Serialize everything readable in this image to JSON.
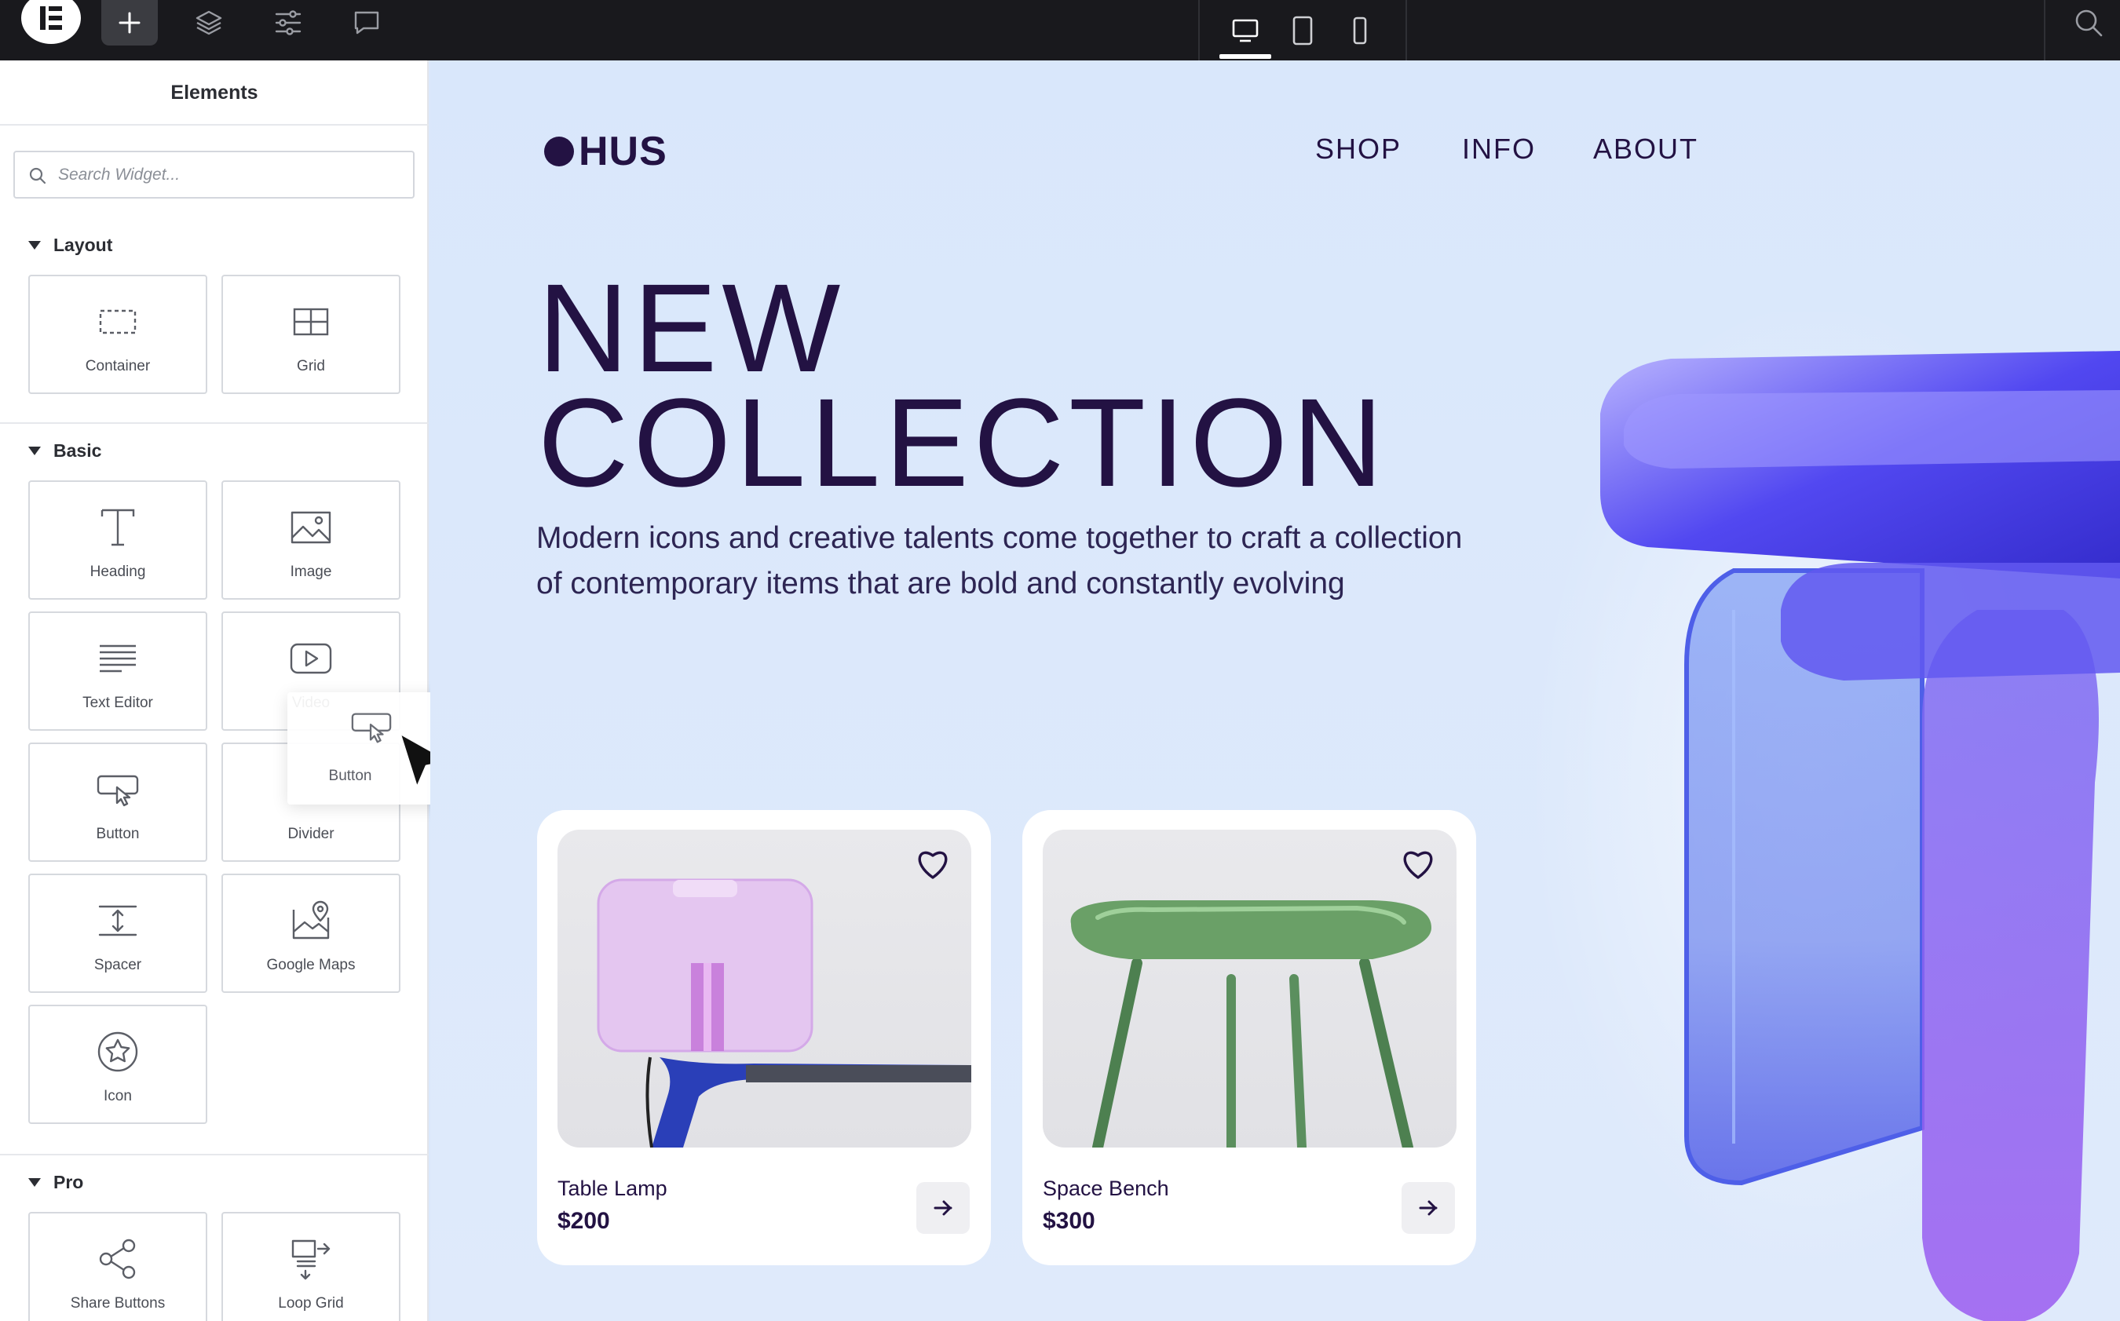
{
  "topbar": {
    "logo_icon": "elementor-logo-icon",
    "tools": [
      "add-icon",
      "layers-icon",
      "settings-sliders-icon",
      "comment-icon"
    ],
    "devices": [
      "desktop-icon",
      "tablet-icon",
      "mobile-icon"
    ],
    "active_device": "desktop",
    "right_icon": "search-icon"
  },
  "sidebar": {
    "title": "Elements",
    "search": {
      "placeholder": "Search Widget..."
    },
    "sections": [
      {
        "label": "Layout",
        "widgets": [
          "Container",
          "Grid"
        ]
      },
      {
        "label": "Basic",
        "widgets": [
          "Heading",
          "Image",
          "Text Editor",
          "Video",
          "Button",
          "Divider",
          "Spacer",
          "Google Maps",
          "Icon"
        ]
      },
      {
        "label": "Pro",
        "widgets": [
          "Share Buttons",
          "Loop Grid"
        ]
      }
    ],
    "dragging": {
      "label": "Button"
    }
  },
  "canvas": {
    "brand": "HUS",
    "nav": [
      "SHOP",
      "INFO",
      "ABOUT"
    ],
    "hero": {
      "title_line1": "NEW",
      "title_line2": "COLLECTION",
      "subtitle_line1": "Modern icons and creative talents come together to craft a collection",
      "subtitle_line2": "of contemporary items that are bold and constantly evolving"
    },
    "products": [
      {
        "name": "Table Lamp",
        "price": "$200"
      },
      {
        "name": "Space Bench",
        "price": "$300"
      }
    ]
  },
  "colors": {
    "topbar": "#19191d",
    "canvas_bg": "#dbe8fb",
    "brand_text": "#231243",
    "drag_badge": "#39b54a"
  }
}
